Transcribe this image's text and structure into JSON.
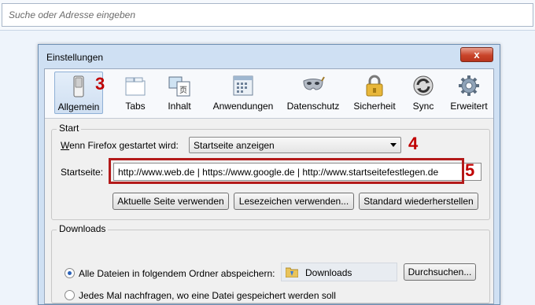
{
  "address_bar": {
    "placeholder": "Suche oder Adresse eingeben"
  },
  "dialog": {
    "title": "Einstellungen",
    "close_glyph": "x"
  },
  "toolbar": {
    "panes": [
      {
        "label": "Allgemein",
        "icon": "general-switch-icon",
        "selected": true
      },
      {
        "label": "Tabs",
        "icon": "tabs-icon"
      },
      {
        "label": "Inhalt",
        "icon": "content-icon"
      },
      {
        "label": "Anwendungen",
        "icon": "applications-icon"
      },
      {
        "label": "Datenschutz",
        "icon": "privacy-mask-icon"
      },
      {
        "label": "Sicherheit",
        "icon": "padlock-icon"
      },
      {
        "label": "Sync",
        "icon": "sync-icon"
      },
      {
        "label": "Erweitert",
        "icon": "gear-icon"
      }
    ]
  },
  "steps": {
    "three": "3",
    "four": "4",
    "five": "5"
  },
  "start": {
    "legend": "Start",
    "startup_label": "Wenn Firefox gestartet wird:",
    "startup_value": "Startseite anzeigen",
    "homepage_label": "Startseite:",
    "homepage_value": "http://www.web.de | https://www.google.de | http://www.startseitefestlegen.de",
    "buttons": {
      "current": "Aktuelle Seite verwenden",
      "bookmark": "Lesezeichen verwenden...",
      "restore": "Standard wiederherstellen"
    }
  },
  "downloads": {
    "legend": "Downloads",
    "option_save": "Alle Dateien in folgendem Ordner abspeichern:",
    "folder": "Downloads",
    "browse": "Durchsuchen...",
    "option_ask": "Jedes Mal nachfragen, wo eine Datei gespeichert werden soll",
    "selected_option": "save"
  },
  "colors": {
    "accent_red": "#b31a1a",
    "step_red": "#c00000",
    "selection_blue": "#cfdff2"
  }
}
